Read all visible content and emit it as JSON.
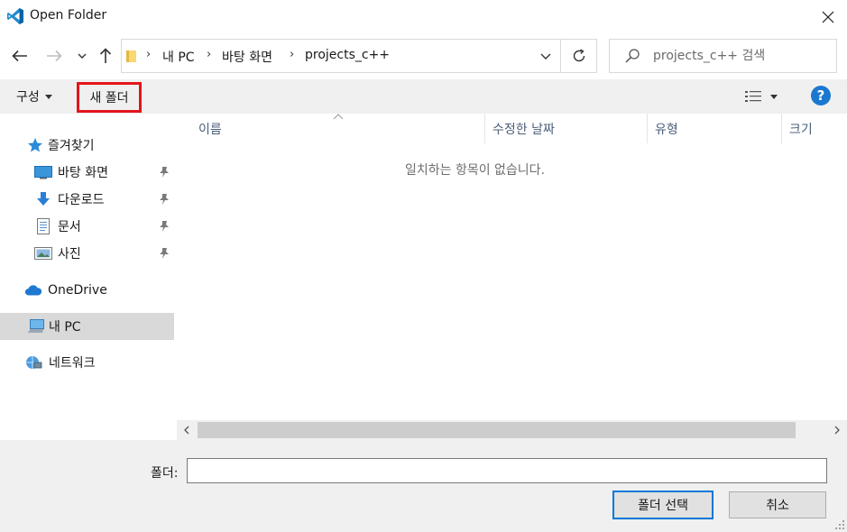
{
  "window": {
    "title": "Open Folder"
  },
  "address": {
    "crumbs": [
      "내 PC",
      "바탕 화면",
      "projects_c++"
    ]
  },
  "search": {
    "placeholder": "projects_c++ 검색"
  },
  "toolbar": {
    "organize_label": "구성",
    "new_folder_label": "새 폴더",
    "help_label": "?"
  },
  "nav": {
    "quick_access": "즐겨찾기",
    "desktop": "바탕 화면",
    "downloads": "다운로드",
    "documents": "문서",
    "pictures": "사진",
    "onedrive": "OneDrive",
    "this_pc": "내 PC",
    "network": "네트워크"
  },
  "columns": {
    "name": "이름",
    "modified": "수정한 날짜",
    "type": "유형",
    "size": "크기"
  },
  "content": {
    "empty_message": "일치하는 항목이 없습니다."
  },
  "bottom": {
    "folder_label": "폴더:",
    "folder_value": "",
    "select_label": "폴더 선택",
    "cancel_label": "취소"
  },
  "colors": {
    "accent": "#0078d7",
    "highlight_box": "#e3141b",
    "help": "#1b78d0",
    "selected_nav": "#d9d9d9"
  }
}
